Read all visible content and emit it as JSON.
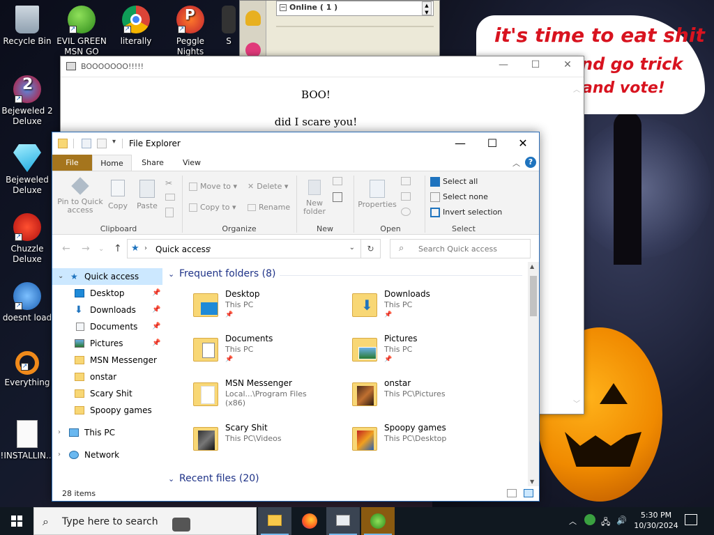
{
  "desktop": {
    "icons": [
      {
        "label": "Recycle Bin"
      },
      {
        "label": "EVIL GREEN MSN GO"
      },
      {
        "label": "literally"
      },
      {
        "label": "Peggle Nights"
      },
      {
        "label": "S"
      },
      {
        "label": "Bejeweled 2 Deluxe"
      },
      {
        "label": "Bejeweled Deluxe"
      },
      {
        "label": "Chuzzle Deluxe"
      },
      {
        "label": "doesnt load"
      },
      {
        "label": "Everything"
      },
      {
        "label": "!INSTALLIN..."
      }
    ],
    "speech": {
      "line1": "it's time to eat shit",
      "line2": "nd go trick",
      "line3": "and vote!"
    }
  },
  "messenger_window": {
    "online": "Online ( 1 )"
  },
  "boo_window": {
    "title": "BOOOOOOO!!!!!",
    "heading": "BOO!",
    "line": "did I scare you!",
    "min": "—",
    "max": "☐",
    "close": "✕"
  },
  "explorer": {
    "title": "File Explorer",
    "tabs": [
      "File",
      "Home",
      "Share",
      "View"
    ],
    "ribbon": {
      "pin": "Pin to Quick access",
      "copy": "Copy",
      "paste": "Paste",
      "move_to": "Move to",
      "copy_to": "Copy to",
      "delete": "Delete",
      "rename": "Rename",
      "new_folder": "New folder",
      "properties": "Properties",
      "select_all": "Select all",
      "select_none": "Select none",
      "invert_selection": "Invert selection",
      "groups": [
        "Clipboard",
        "Organize",
        "New",
        "Open",
        "Select"
      ]
    },
    "address": {
      "crumb": "Quick access",
      "search_placeholder": "Search Quick access"
    },
    "nav": [
      {
        "label": "Quick access",
        "pinned": false
      },
      {
        "label": "Desktop",
        "pinned": true
      },
      {
        "label": "Downloads",
        "pinned": true
      },
      {
        "label": "Documents",
        "pinned": true
      },
      {
        "label": "Pictures",
        "pinned": true
      },
      {
        "label": "MSN Messenger",
        "pinned": false
      },
      {
        "label": "onstar",
        "pinned": false
      },
      {
        "label": "Scary Shit",
        "pinned": false
      },
      {
        "label": "Spoopy games",
        "pinned": false
      },
      {
        "label": "This PC",
        "pinned": false
      },
      {
        "label": "Network",
        "pinned": false
      }
    ],
    "frequent_header": "Frequent folders (8)",
    "recent_header": "Recent files (20)",
    "folders": [
      {
        "name": "Desktop",
        "path": "This PC"
      },
      {
        "name": "Downloads",
        "path": "This PC"
      },
      {
        "name": "Documents",
        "path": "This PC"
      },
      {
        "name": "Pictures",
        "path": "This PC"
      },
      {
        "name": "MSN Messenger",
        "path": "Local...\\Program Files (x86)"
      },
      {
        "name": "onstar",
        "path": "This PC\\Pictures"
      },
      {
        "name": "Scary Shit",
        "path": "This PC\\Videos"
      },
      {
        "name": "Spoopy games",
        "path": "This PC\\Desktop"
      }
    ],
    "status": "28 items"
  },
  "taskbar": {
    "search_placeholder": "Type here to search",
    "time": "5:30 PM",
    "date": "10/30/2024"
  },
  "colors": {
    "accent": "#1e73be",
    "file_tab": "#a5751d",
    "selected": "#cce8ff",
    "speech_text": "#d8131f"
  }
}
